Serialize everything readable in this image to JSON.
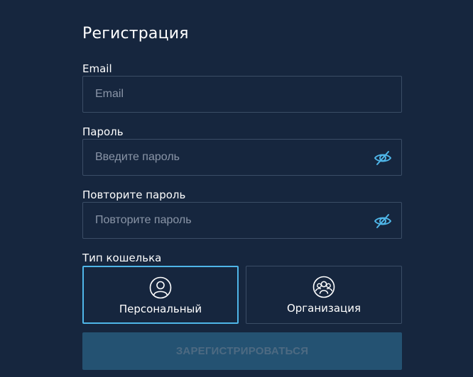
{
  "form": {
    "title": "Регистрация",
    "email": {
      "label": "Email",
      "placeholder": "Email",
      "value": ""
    },
    "password": {
      "label": "Пароль",
      "placeholder": "Введите пароль",
      "value": "",
      "icon": "eye-off-icon"
    },
    "password_confirm": {
      "label": "Повторите пароль",
      "placeholder": "Повторите пароль",
      "value": "",
      "icon": "eye-off-icon"
    },
    "wallet_type": {
      "label": "Тип кошелька",
      "options": [
        {
          "label": "Персональный",
          "icon": "user-icon",
          "selected": true
        },
        {
          "label": "Организация",
          "icon": "group-icon",
          "selected": false
        }
      ]
    },
    "submit_label": "ЗАРЕГИСТРИРОВАТЬСЯ"
  },
  "colors": {
    "background": "#16263e",
    "border": "#3b4d66",
    "accent": "#4fb6e8",
    "button_bg": "#245272",
    "button_text": "#4d6a82",
    "placeholder": "#8a95a7"
  }
}
